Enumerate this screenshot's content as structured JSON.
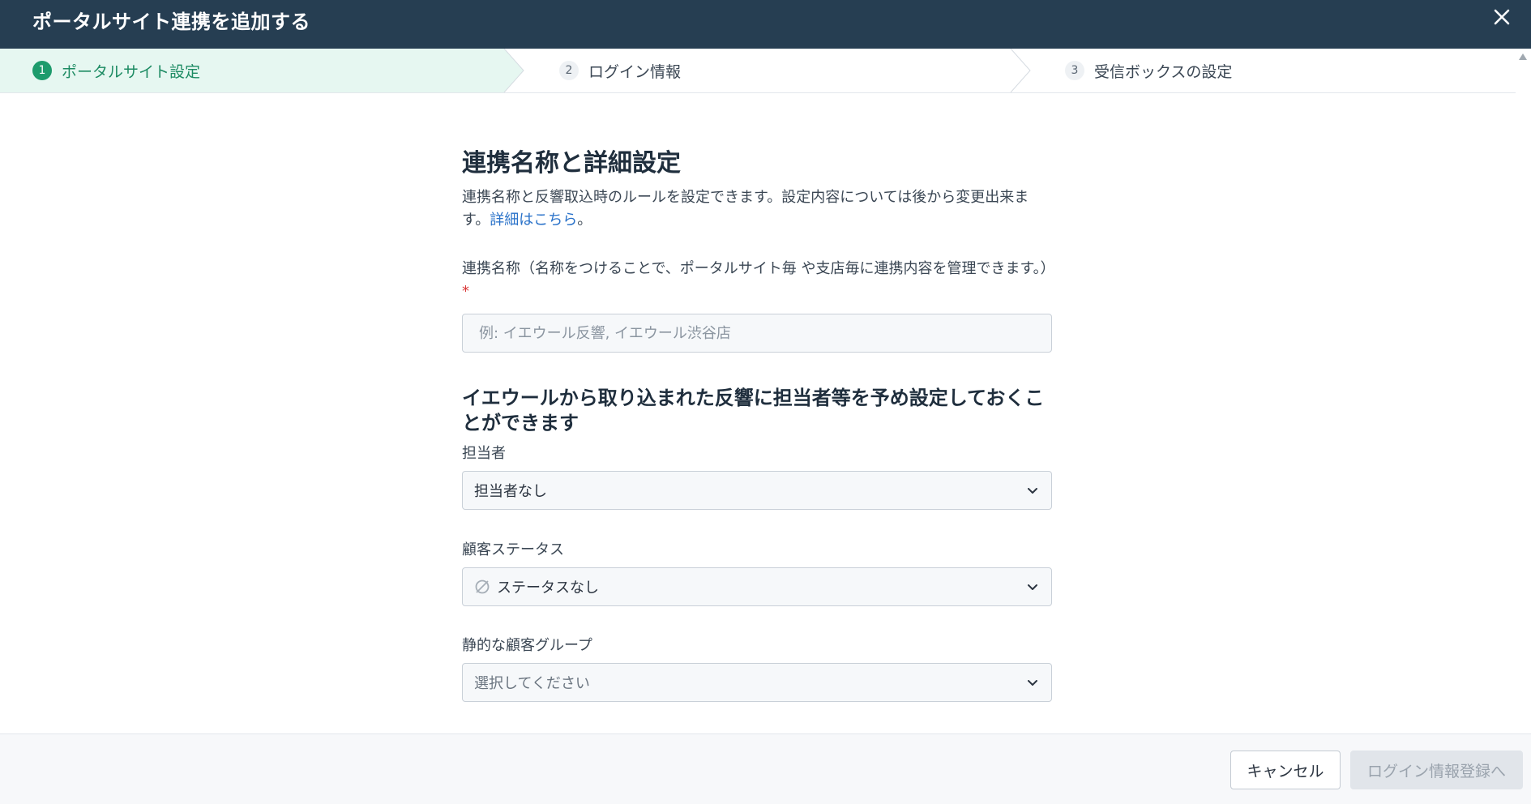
{
  "header": {
    "title": "ポータルサイト連携を追加する"
  },
  "stepper": {
    "steps": [
      {
        "number": "1",
        "label": "ポータルサイト設定",
        "state": "active"
      },
      {
        "number": "2",
        "label": "ログイン情報",
        "state": "inactive"
      },
      {
        "number": "3",
        "label": "受信ボックスの設定",
        "state": "inactive"
      }
    ]
  },
  "section": {
    "title": "連携名称と詳細設定",
    "description": "連携名称と反響取込時のルールを設定できます。設定内容については後から変更出来ます。",
    "link_text": "詳細はこちら",
    "link_suffix": "。"
  },
  "name_field": {
    "label": "連携名称（名称をつけることで、ポータルサイト毎 や支店毎に連携内容を管理できます。）",
    "required_mark": "*",
    "placeholder": "例: イエウール反響, イエウール渋谷店",
    "value": ""
  },
  "preset": {
    "title": "イエウールから取り込まれた反響に担当者等を予め設定しておくことができます",
    "assignee": {
      "label": "担当者",
      "value": "担当者なし"
    },
    "status": {
      "label": "顧客ステータス",
      "value": "ステータスなし"
    },
    "group": {
      "label": "静的な顧客グループ",
      "value": "選択してください"
    }
  },
  "footer": {
    "cancel_label": "キャンセル",
    "next_label": "ログイン情報登録へ"
  },
  "colors": {
    "header_bg": "#263e52",
    "active_step_bg": "#e6f7f1",
    "active_step_accent": "#1d9b6c",
    "link": "#2a72c9",
    "required": "#d93838"
  }
}
